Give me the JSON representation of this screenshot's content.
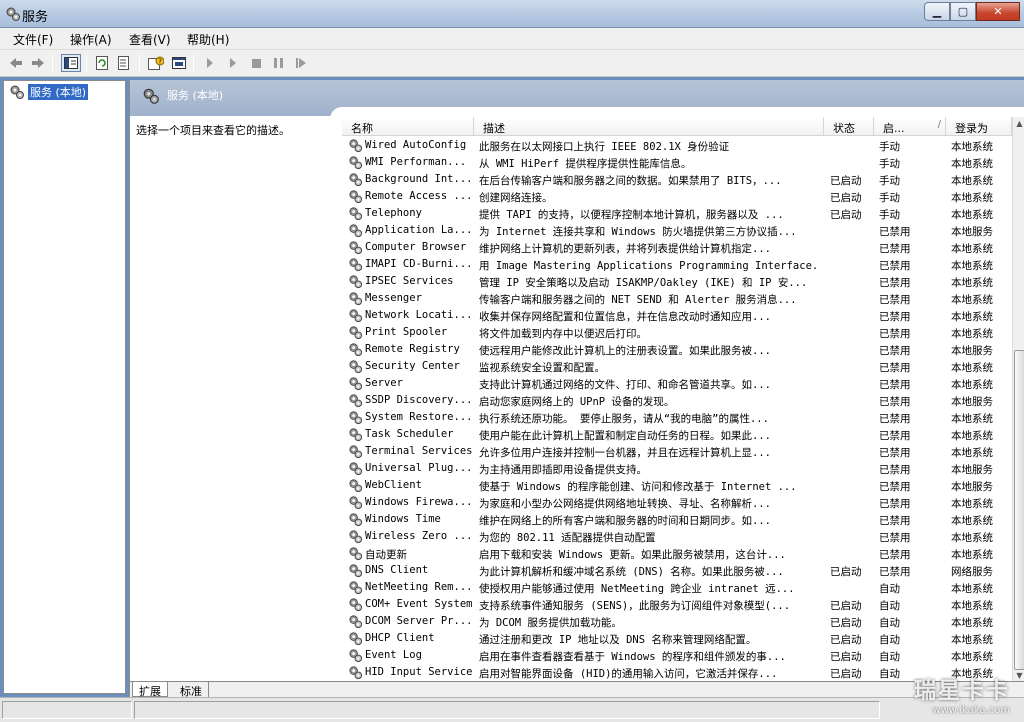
{
  "window": {
    "title": "服务",
    "min_label": "▁",
    "max_label": "▢",
    "close_label": "✕"
  },
  "menu": [
    "文件(F)",
    "操作(A)",
    "查看(V)",
    "帮助(H)"
  ],
  "toolbar": {
    "icons": [
      "back-icon",
      "forward-icon",
      "show-hide-tree-icon",
      "refresh-icon",
      "export-list-icon",
      "help-icon",
      "properties-icon",
      "start-service-icon",
      "start-service-icon",
      "stop-service-icon",
      "pause-service-icon",
      "restart-service-icon"
    ]
  },
  "tree": {
    "root_label": "服务 (本地)"
  },
  "pane": {
    "title": "服务 (本地)",
    "description_hint": "选择一个项目来查看它的描述。",
    "columns": [
      "名称",
      "描述",
      "状态",
      "启...",
      "登录为"
    ],
    "sort_indicator": "/",
    "tabs": [
      "扩展",
      "标准"
    ]
  },
  "rows": [
    {
      "name": "Wired AutoConfig",
      "desc": "此服务在以太网接口上执行 IEEE 802.1X 身份验证",
      "status": "",
      "startup": "手动",
      "logon": "本地系统"
    },
    {
      "name": "WMI Performan...",
      "desc": "从 WMI HiPerf 提供程序提供性能库信息。",
      "status": "",
      "startup": "手动",
      "logon": "本地系统"
    },
    {
      "name": "Background Int...",
      "desc": "在后台传输客户端和服务器之间的数据。如果禁用了 BITS，...",
      "status": "已启动",
      "startup": "手动",
      "logon": "本地系统"
    },
    {
      "name": "Remote Access ...",
      "desc": "创建网络连接。",
      "status": "已启动",
      "startup": "手动",
      "logon": "本地系统"
    },
    {
      "name": "Telephony",
      "desc": "提供 TAPI 的支持，以便程序控制本地计算机，服务器以及 ...",
      "status": "已启动",
      "startup": "手动",
      "logon": "本地系统"
    },
    {
      "name": "Application La...",
      "desc": "为 Internet 连接共享和 Windows 防火墙提供第三方协议插...",
      "status": "",
      "startup": "已禁用",
      "logon": "本地服务"
    },
    {
      "name": "Computer Browser",
      "desc": "维护网络上计算机的更新列表，并将列表提供给计算机指定...",
      "status": "",
      "startup": "已禁用",
      "logon": "本地系统"
    },
    {
      "name": "IMAPI CD-Burni...",
      "desc": "用 Image Mastering Applications Programming Interface...",
      "status": "",
      "startup": "已禁用",
      "logon": "本地系统"
    },
    {
      "name": "IPSEC Services",
      "desc": "管理 IP 安全策略以及启动 ISAKMP/Oakley (IKE) 和 IP 安...",
      "status": "",
      "startup": "已禁用",
      "logon": "本地系统"
    },
    {
      "name": "Messenger",
      "desc": "传输客户端和服务器之间的 NET SEND 和 Alerter 服务消息...",
      "status": "",
      "startup": "已禁用",
      "logon": "本地系统"
    },
    {
      "name": "Network Locati...",
      "desc": "收集并保存网络配置和位置信息，并在信息改动时通知应用...",
      "status": "",
      "startup": "已禁用",
      "logon": "本地系统"
    },
    {
      "name": "Print Spooler",
      "desc": "将文件加载到内存中以便迟后打印。",
      "status": "",
      "startup": "已禁用",
      "logon": "本地系统"
    },
    {
      "name": "Remote Registry",
      "desc": "使远程用户能修改此计算机上的注册表设置。如果此服务被...",
      "status": "",
      "startup": "已禁用",
      "logon": "本地服务"
    },
    {
      "name": "Security Center",
      "desc": "监视系统安全设置和配置。",
      "status": "",
      "startup": "已禁用",
      "logon": "本地系统"
    },
    {
      "name": "Server",
      "desc": "支持此计算机通过网络的文件、打印、和命名管道共享。如...",
      "status": "",
      "startup": "已禁用",
      "logon": "本地系统"
    },
    {
      "name": "SSDP Discovery...",
      "desc": "启动您家庭网络上的 UPnP 设备的发现。",
      "status": "",
      "startup": "已禁用",
      "logon": "本地服务"
    },
    {
      "name": "System Restore...",
      "desc": "执行系统还原功能。 要停止服务，请从“我的电脑”的属性...",
      "status": "",
      "startup": "已禁用",
      "logon": "本地系统"
    },
    {
      "name": "Task Scheduler",
      "desc": "使用户能在此计算机上配置和制定自动任务的日程。如果此...",
      "status": "",
      "startup": "已禁用",
      "logon": "本地系统"
    },
    {
      "name": "Terminal Services",
      "desc": "允许多位用户连接并控制一台机器，并且在远程计算机上显...",
      "status": "",
      "startup": "已禁用",
      "logon": "本地系统"
    },
    {
      "name": "Universal Plug...",
      "desc": "为主持通用即插即用设备提供支持。",
      "status": "",
      "startup": "已禁用",
      "logon": "本地服务"
    },
    {
      "name": "WebClient",
      "desc": "使基于 Windows 的程序能创建、访问和修改基于 Internet ...",
      "status": "",
      "startup": "已禁用",
      "logon": "本地服务"
    },
    {
      "name": "Windows Firewa...",
      "desc": "为家庭和小型办公网络提供网络地址转换、寻址、名称解析...",
      "status": "",
      "startup": "已禁用",
      "logon": "本地系统"
    },
    {
      "name": "Windows Time",
      "desc": "维护在网络上的所有客户端和服务器的时间和日期同步。如...",
      "status": "",
      "startup": "已禁用",
      "logon": "本地系统"
    },
    {
      "name": "Wireless Zero ...",
      "desc": "为您的 802.11 适配器提供自动配置",
      "status": "",
      "startup": "已禁用",
      "logon": "本地系统"
    },
    {
      "name": "自动更新",
      "desc": "启用下载和安装 Windows 更新。如果此服务被禁用，这台计...",
      "status": "",
      "startup": "已禁用",
      "logon": "本地系统"
    },
    {
      "name": "DNS Client",
      "desc": "为此计算机解析和缓冲域名系统 (DNS) 名称。如果此服务被...",
      "status": "已启动",
      "startup": "已禁用",
      "logon": "网络服务"
    },
    {
      "name": "NetMeeting Rem...",
      "desc": "使授权用户能够通过使用 NetMeeting 跨企业 intranet 远...",
      "status": "",
      "startup": "自动",
      "logon": "本地系统"
    },
    {
      "name": "COM+ Event System",
      "desc": "支持系统事件通知服务 (SENS)，此服务为订阅组件对象模型(...",
      "status": "已启动",
      "startup": "自动",
      "logon": "本地系统"
    },
    {
      "name": "DCOM Server Pr...",
      "desc": "为 DCOM 服务提供加载功能。",
      "status": "已启动",
      "startup": "自动",
      "logon": "本地系统"
    },
    {
      "name": "DHCP Client",
      "desc": "通过注册和更改 IP 地址以及 DNS 名称来管理网络配置。",
      "status": "已启动",
      "startup": "自动",
      "logon": "本地系统"
    },
    {
      "name": "Event Log",
      "desc": "启用在事件查看器查看基于 Windows 的程序和组件颁发的事...",
      "status": "已启动",
      "startup": "自动",
      "logon": "本地系统"
    },
    {
      "name": "HID Input Service",
      "desc": "启用对智能界面设备 (HID)的通用输入访问，它激活并保存...",
      "status": "已启动",
      "startup": "自动",
      "logon": "本地系统"
    }
  ],
  "watermark": {
    "line1": "瑞星卡卡",
    "line2": "www.ikaka.com"
  }
}
